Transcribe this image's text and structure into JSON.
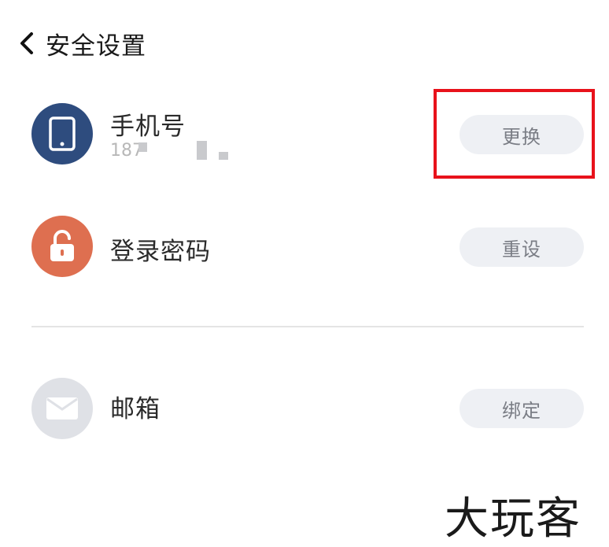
{
  "header": {
    "title": "安全设置"
  },
  "phone": {
    "label": "手机号",
    "number_visible": "187",
    "action": "更换",
    "icon_color": "#2e4c7e"
  },
  "password": {
    "label": "登录密码",
    "action": "重设",
    "icon_color": "#de6f50"
  },
  "email": {
    "label": "邮箱",
    "action": "绑定",
    "icon_color": "#dfe1e6"
  },
  "highlight_color": "#e8121b",
  "watermark": "大玩客",
  "icons": [
    "chevron-left-icon",
    "phone-icon",
    "lock-icon",
    "mail-icon"
  ]
}
